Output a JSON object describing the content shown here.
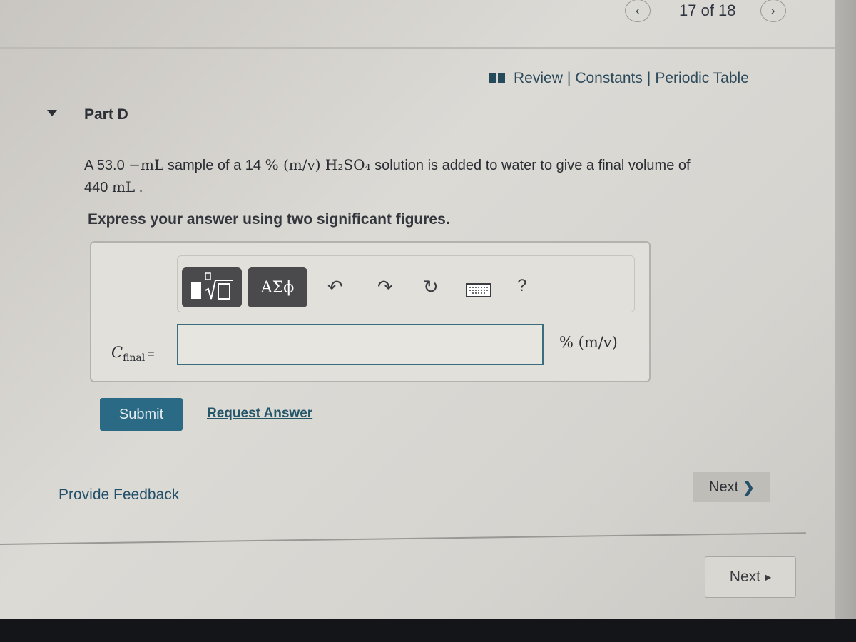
{
  "header": {
    "pager_text": "17 of 18",
    "prev_icon": "chevron-left-icon",
    "next_icon": "chevron-right-icon"
  },
  "resources": {
    "icon": "book-icon",
    "review": "Review",
    "separator": "|",
    "constants": "Constants",
    "periodic_table": "Periodic Table"
  },
  "part": {
    "toggle_icon": "triangle-down-icon",
    "title": "Part D"
  },
  "question": {
    "text_1": "A 53.0",
    "unit_1": "−mL",
    "text_2": " sample of a 14 ",
    "conc": "% (m/v) H₂SO₄",
    "text_3": " solution is added to water to give a final volume of",
    "volume": "440",
    "unit_2": "mL",
    "end": "."
  },
  "instruction": "Express your answer using two significant figures.",
  "answer": {
    "toolbar": {
      "template_icon": "template-sqrt-icon",
      "greek_label": "ΑΣϕ",
      "undo_icon": "undo-icon",
      "redo_icon": "redo-icon",
      "reset_icon": "reset-icon",
      "keyboard_icon": "keyboard-icon",
      "help_label": "?"
    },
    "variable": "C",
    "subscript": "final",
    "equals": "=",
    "value": "",
    "unit": "% (m/v)"
  },
  "actions": {
    "submit": "Submit",
    "request_answer": "Request Answer"
  },
  "footer": {
    "feedback": "Provide Feedback",
    "next": "Next",
    "next_2": "Next"
  },
  "colors": {
    "primary": "#2a6a84",
    "link": "#24566a"
  }
}
